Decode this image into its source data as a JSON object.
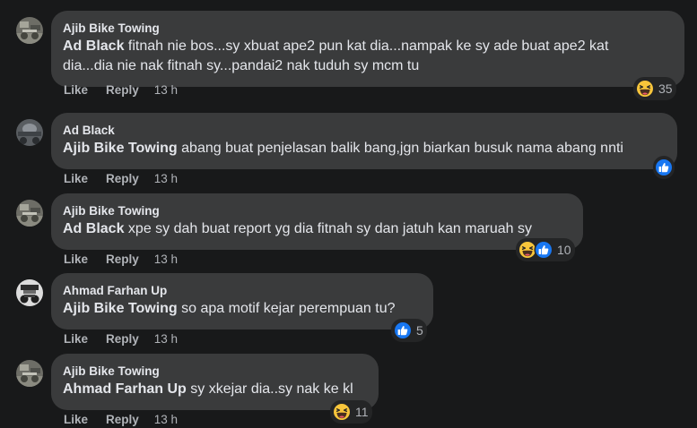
{
  "comments": [
    {
      "author": "Ajib Bike Towing",
      "mention": "Ad Black",
      "text_line1": " fitnah nie bos...sy xbuat ape2 pun kat dia...nampak ke sy ade buat ape2 kat",
      "text_line2": "dia...dia nie nak fitnah sy...pandai2 nak tuduh sy mcm tu",
      "like_label": "Like",
      "reply_label": "Reply",
      "time": "13 h",
      "reactions": [
        "haha-icon"
      ],
      "reaction_count": "35"
    },
    {
      "author": "Ad Black",
      "mention": "Ajib Bike Towing",
      "text_line1": " abang buat penjelasan balik bang,jgn biarkan busuk nama abang nnti",
      "like_label": "Like",
      "reply_label": "Reply",
      "time": "13 h",
      "reactions": [
        "like-icon"
      ],
      "reaction_count": ""
    },
    {
      "author": "Ajib Bike Towing",
      "mention": "Ad Black",
      "text_line1": " xpe sy dah buat report yg dia fitnah sy dan jatuh kan maruah sy",
      "like_label": "Like",
      "reply_label": "Reply",
      "time": "13 h",
      "reactions": [
        "haha-icon",
        "like-icon"
      ],
      "reaction_count": "10"
    },
    {
      "author": "Ahmad Farhan Up",
      "mention": "Ajib Bike Towing",
      "text_line1": " so apa motif kejar perempuan tu?",
      "like_label": "Like",
      "reply_label": "Reply",
      "time": "13 h",
      "reactions": [
        "like-icon"
      ],
      "reaction_count": "5"
    },
    {
      "author": "Ajib Bike Towing",
      "mention": "Ahmad Farhan Up",
      "text_line1": " sy xkejar dia..sy nak ke kl",
      "like_label": "Like",
      "reply_label": "Reply",
      "time": "13 h",
      "reactions": [
        "haha-icon"
      ],
      "reaction_count": "11"
    }
  ],
  "colors": {
    "background": "#18191a",
    "bubble": "#3a3b3c",
    "text": "#e4e6eb",
    "secondary_text": "#b0b3b8",
    "like_blue": "#1877f2",
    "haha_yellow": "#f7c53b"
  }
}
